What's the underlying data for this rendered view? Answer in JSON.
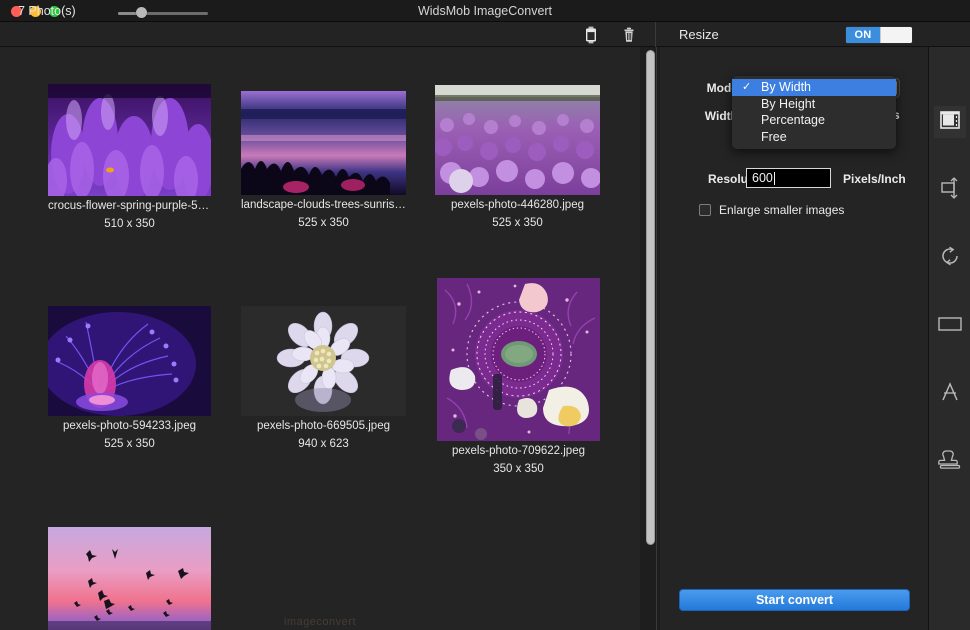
{
  "window": {
    "title": "WidsMob ImageConvert",
    "controls": [
      "close",
      "minimize",
      "zoom"
    ]
  },
  "toolbar": {
    "photo_count": "7 Photo(s)",
    "zoom_slider_value": 22,
    "export_icon": "export-icon",
    "trash_icon": "trash-icon",
    "resize_label": "Resize",
    "toggle_on_label": "ON",
    "toggle_state": "on"
  },
  "photos": [
    {
      "name": "crocus-flower-spring-purple-5999...",
      "dimensions": "510 x 350"
    },
    {
      "name": "landscape-clouds-trees-sunrise-2...",
      "dimensions": "525 x 350"
    },
    {
      "name": "pexels-photo-446280.jpeg",
      "dimensions": "525 x 350"
    },
    {
      "name": "pexels-photo-594233.jpeg",
      "dimensions": "525 x 350"
    },
    {
      "name": "pexels-photo-669505.jpeg",
      "dimensions": "940 x 623"
    },
    {
      "name": "pexels-photo-709622.jpeg",
      "dimensions": "350 x 350"
    },
    {
      "name": "",
      "dimensions": ""
    }
  ],
  "watermark": "imageconvert",
  "panel": {
    "mode_label": "Mode:",
    "mode_selected": "By Width",
    "mode_options": [
      "By Width",
      "By Height",
      "Percentage",
      "Free"
    ],
    "check_glyph": "✓",
    "width_label": "Width:",
    "width_unit_partial": "s",
    "resolution_label": "Resolution:",
    "resolution_value": "600",
    "resolution_unit": "Pixels/Inch",
    "enlarge_label": "Enlarge smaller images",
    "enlarge_checked": false,
    "start_button": "Start convert"
  },
  "rail": {
    "items": [
      {
        "name": "resize-icon",
        "active": true
      },
      {
        "name": "crop-icon",
        "active": false
      },
      {
        "name": "rotate-icon",
        "active": false
      },
      {
        "name": "border-icon",
        "active": false
      },
      {
        "name": "text-icon",
        "active": false
      },
      {
        "name": "watermark-stamp-icon",
        "active": false
      }
    ]
  },
  "colors": {
    "accent": "#3c7fe0",
    "button": "#247ada",
    "window_bg": "#242424",
    "toolbar_bg": "#232323"
  }
}
